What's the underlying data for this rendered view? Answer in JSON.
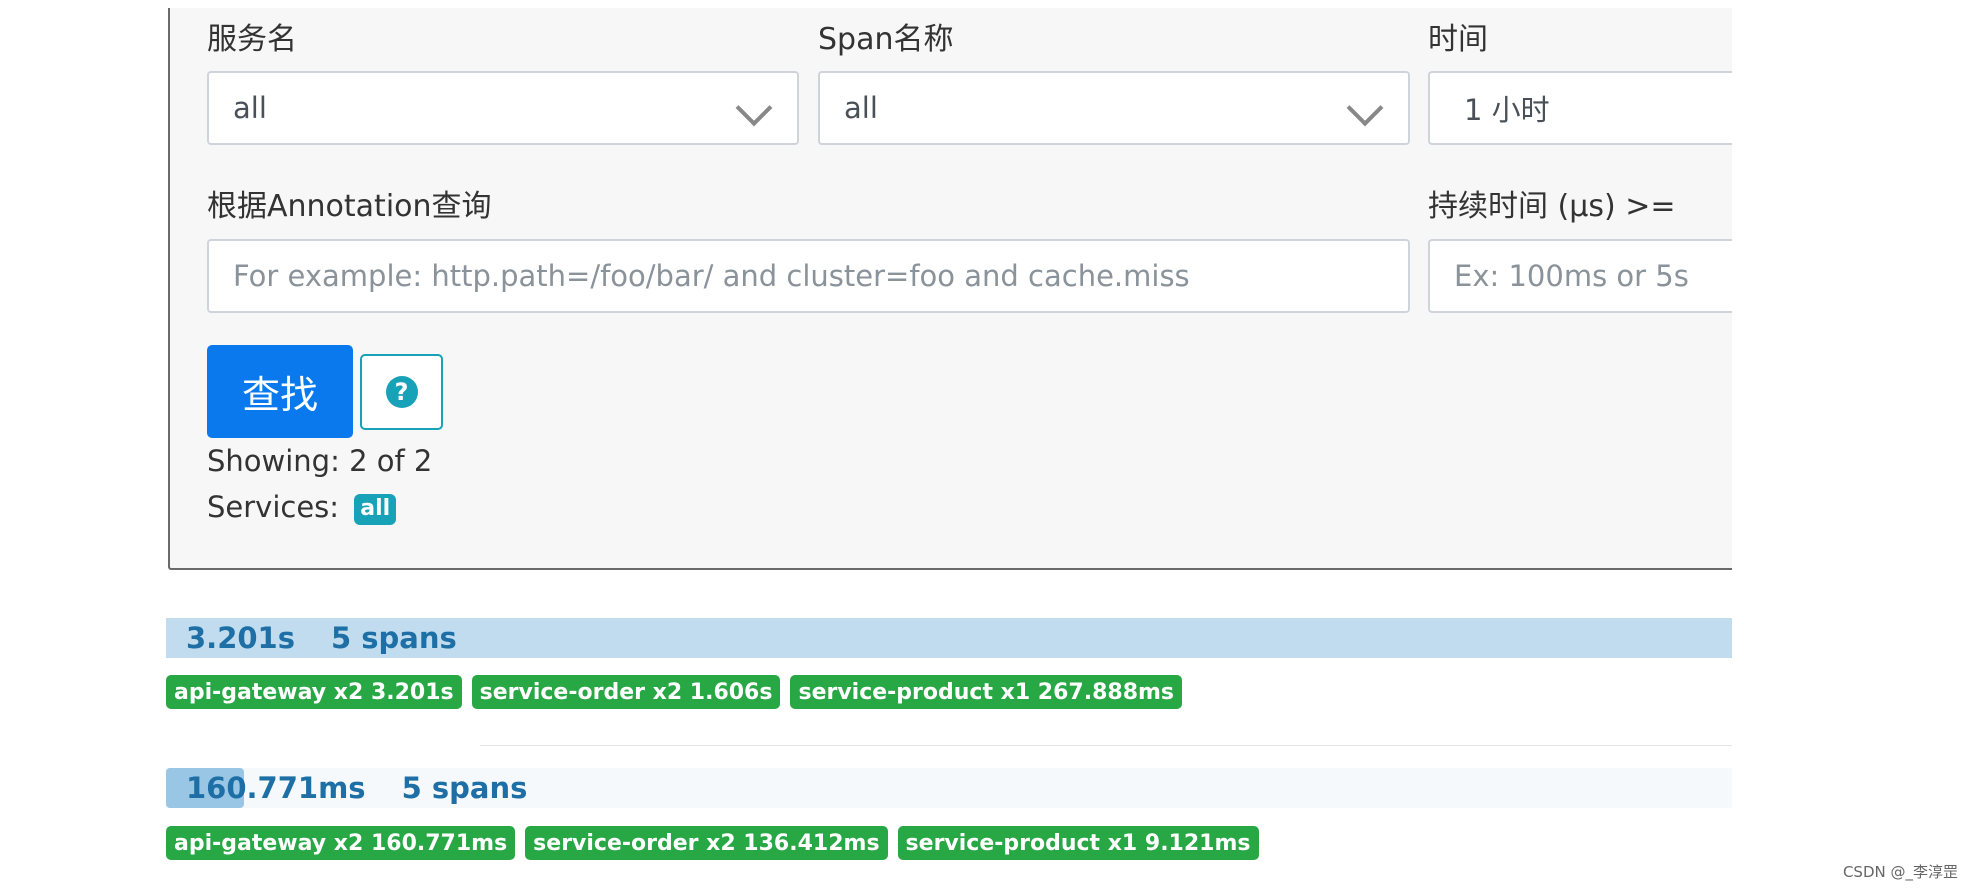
{
  "search": {
    "service_label": "服务名",
    "service_value": "all",
    "span_label": "Span名称",
    "span_value": "all",
    "time_label": "时间",
    "time_value": "1 小时",
    "annotation_label": "根据Annotation查询",
    "annotation_placeholder": "For example: http.path=/foo/bar/ and cluster=foo and cache.miss",
    "duration_label": "持续时间 (μs) >=",
    "duration_placeholder": "Ex: 100ms or 5s",
    "find_button": "查找",
    "help_icon": "question-circle-icon"
  },
  "results": {
    "showing": "Showing: 2 of 2",
    "services_label": "Services:",
    "services_badge": "all"
  },
  "traces": [
    {
      "duration": "3.201s",
      "spans": "5 spans",
      "relative_fraction": 1.0,
      "tags": [
        "api-gateway x2 3.201s",
        "service-order x2 1.606s",
        "service-product x1 267.888ms"
      ]
    },
    {
      "duration": "160.771ms",
      "spans": "5 spans",
      "relative_fraction": 0.05,
      "tags": [
        "api-gateway x2 160.771ms",
        "service-order x2 136.412ms",
        "service-product x1 9.121ms"
      ]
    }
  ],
  "watermark": "CSDN @_李淳罡",
  "colors": {
    "primary": "#0a79ee",
    "info": "#17a2b8",
    "success": "#28a745",
    "trace_bar": "#c0dcee"
  }
}
